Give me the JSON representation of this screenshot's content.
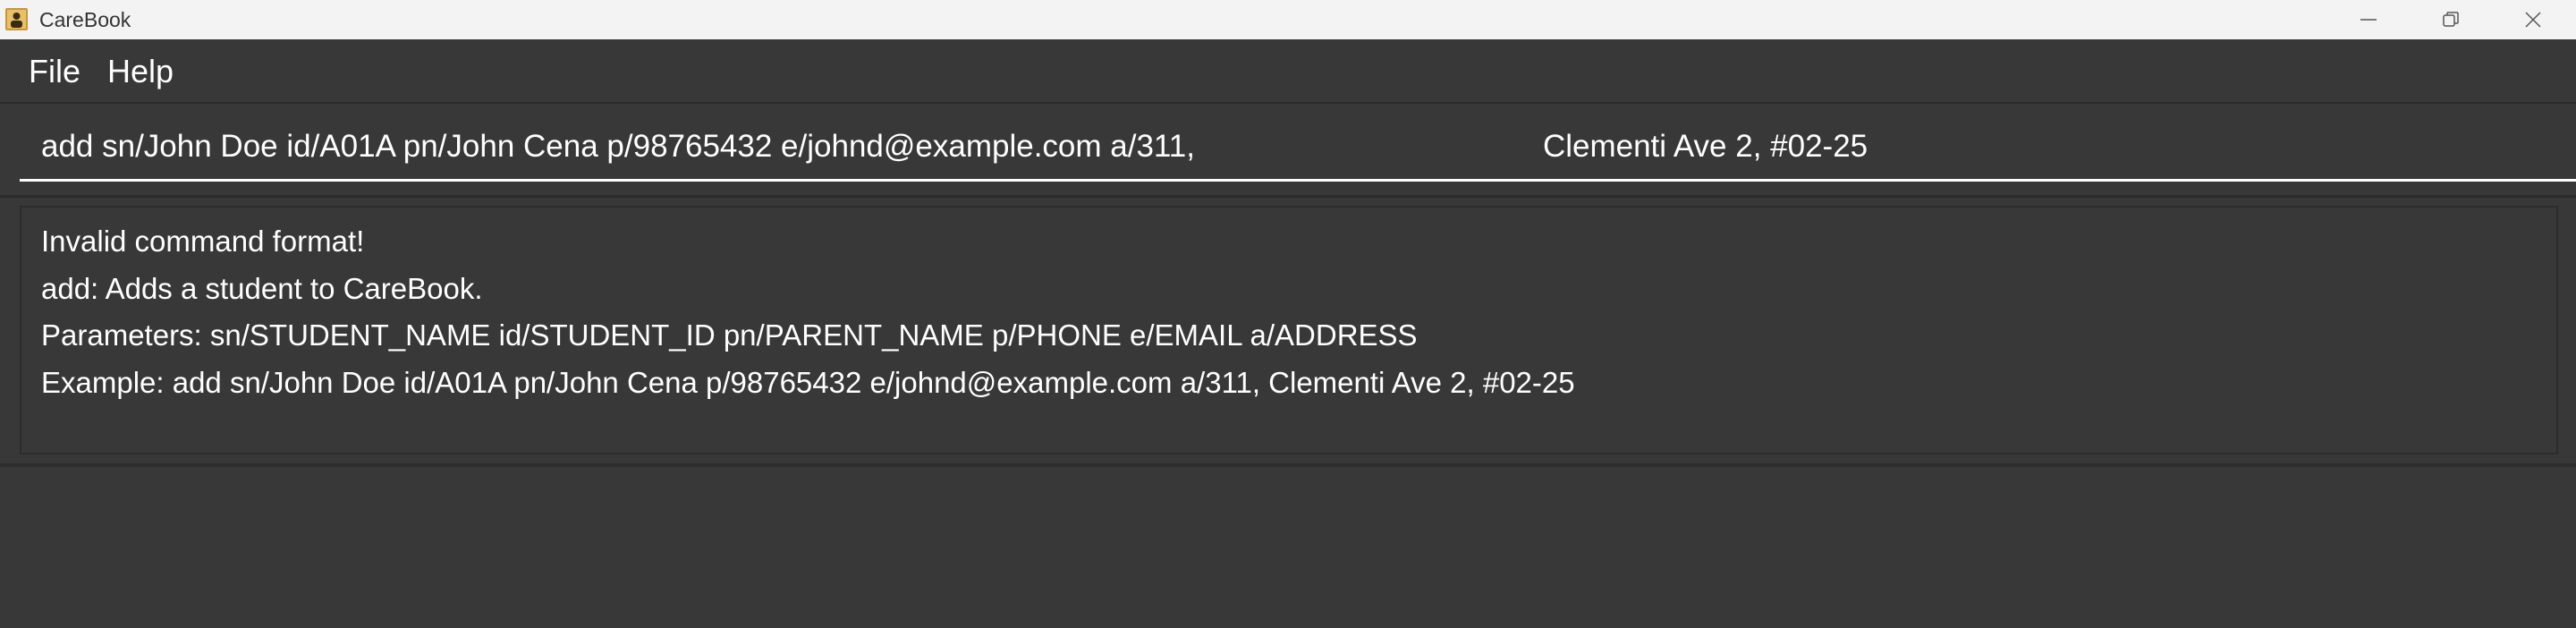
{
  "window": {
    "title": "CareBook"
  },
  "menu": {
    "items": [
      {
        "label": "File"
      },
      {
        "label": "Help"
      }
    ]
  },
  "command_box": {
    "value": "add sn/John Doe id/A01A pn/John Cena p/98765432 e/johnd@example.com a/311,                                        Clementi Ave 2, #02-25"
  },
  "result_display": {
    "lines": [
      "Invalid command format!",
      "add: Adds a student to CareBook.",
      "Parameters: sn/STUDENT_NAME id/STUDENT_ID pn/PARENT_NAME p/PHONE e/EMAIL a/ADDRESS",
      "Example: add sn/John Doe id/A01A pn/John Cena p/98765432 e/johnd@example.com a/311, Clementi Ave 2, #02-25"
    ]
  },
  "icons": {
    "app": "app-icon",
    "minimize": "minimize-icon",
    "maximize": "restore-icon",
    "close": "close-icon"
  },
  "colors": {
    "background": "#383838",
    "text": "#ffffff",
    "titlebar": "#f3f3f3"
  }
}
